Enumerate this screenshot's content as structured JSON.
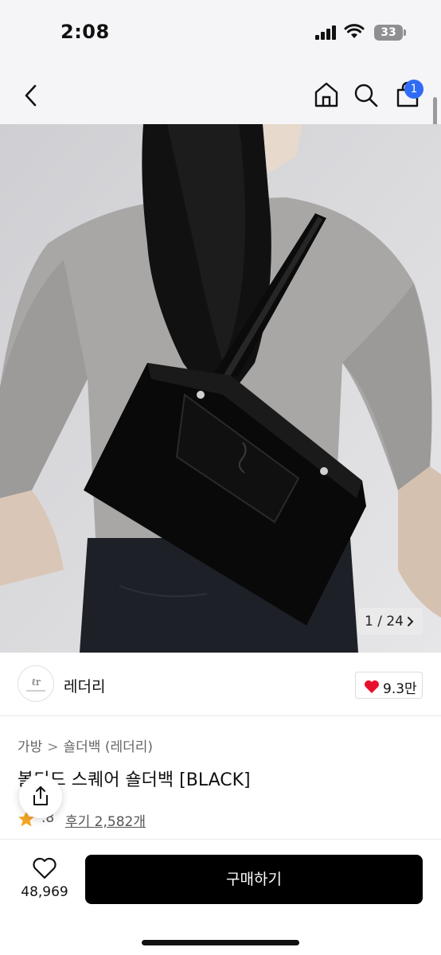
{
  "status_bar": {
    "time": "2:08",
    "battery": "33"
  },
  "nav": {
    "back_icon": "chevron-left-icon",
    "home_icon": "home-icon",
    "search_icon": "search-icon",
    "cart_icon": "shopping-bag-icon",
    "cart_badge": "1"
  },
  "gallery": {
    "counter": "1 / 24",
    "next_icon": "chevron-right-icon"
  },
  "store": {
    "name": "레더리",
    "like_count": "9.3만",
    "heart_color": "#e8112d"
  },
  "product": {
    "breadcrumb": [
      "가방",
      "숄더백 (레더리)"
    ],
    "title": "볼티드 스퀘어 숄더백 [BLACK]",
    "rating_score": ".8",
    "reviews": "후기 2,582개",
    "star_color": "#f5a623"
  },
  "bottom_bar": {
    "wish_count": "48,969",
    "buy_label": "구매하기",
    "buy_color": "#000000"
  }
}
